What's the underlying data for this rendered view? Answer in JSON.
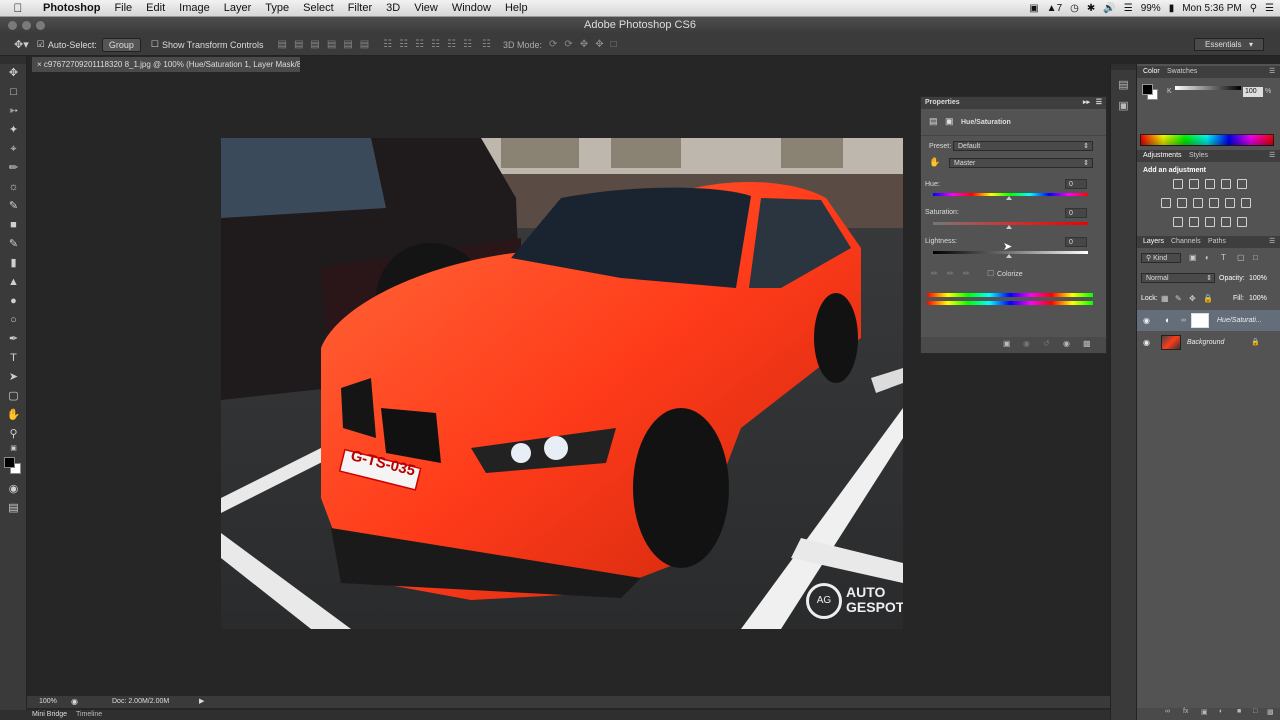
{
  "menubar": {
    "app_name": "Photoshop",
    "items": [
      "File",
      "Edit",
      "Image",
      "Layer",
      "Type",
      "Select",
      "Filter",
      "3D",
      "View",
      "Window",
      "Help"
    ],
    "status": {
      "adobe_num": "7",
      "battery": "99%",
      "clock": "Mon 5:36 PM"
    }
  },
  "window": {
    "title": "Adobe Photoshop CS6"
  },
  "options": {
    "auto_select_label": "Auto-Select:",
    "auto_select_value": "Group",
    "transform_label": "Show Transform Controls",
    "mode3d_label": "3D Mode:",
    "workspace": "Essentials"
  },
  "document": {
    "tab_title": "c97672709201118320 8_1.jpg @ 100% (Hue/Saturation 1, Layer Mask/8) *",
    "watermark_line1": "AUTO",
    "watermark_line2": "GESPOT",
    "plate": "G-TS-035"
  },
  "status": {
    "zoom": "100%",
    "doc": "Doc: 2.00M/2.00M"
  },
  "bottom_tabs": [
    "Mini Bridge",
    "Timeline"
  ],
  "properties": {
    "panel_title": "Properties",
    "adjust_name": "Hue/Saturation",
    "preset_label": "Preset:",
    "preset_value": "Default",
    "channel_value": "Master",
    "hue_label": "Hue:",
    "hue_value": "0",
    "saturation_label": "Saturation:",
    "saturation_value": "0",
    "lightness_label": "Lightness:",
    "lightness_value": "0",
    "colorize_label": "Colorize"
  },
  "color_panel": {
    "tabs": [
      "Color",
      "Swatches"
    ],
    "channel_label": "K",
    "k_value": "100",
    "k_unit": "%"
  },
  "adjustments_panel": {
    "tabs": [
      "Adjustments",
      "Styles"
    ],
    "hint": "Add an adjustment"
  },
  "layers_panel": {
    "tabs": [
      "Layers",
      "Channels",
      "Paths"
    ],
    "filter_kind": "Kind",
    "blend_mode": "Normal",
    "opacity_label": "Opacity:",
    "opacity_value": "100%",
    "lock_label": "Lock:",
    "fill_label": "Fill:",
    "fill_value": "100%",
    "layers": [
      {
        "name": "Hue/Saturati..."
      },
      {
        "name": "Background"
      }
    ]
  },
  "colors": {
    "accent_car": "#ff3b1a"
  }
}
